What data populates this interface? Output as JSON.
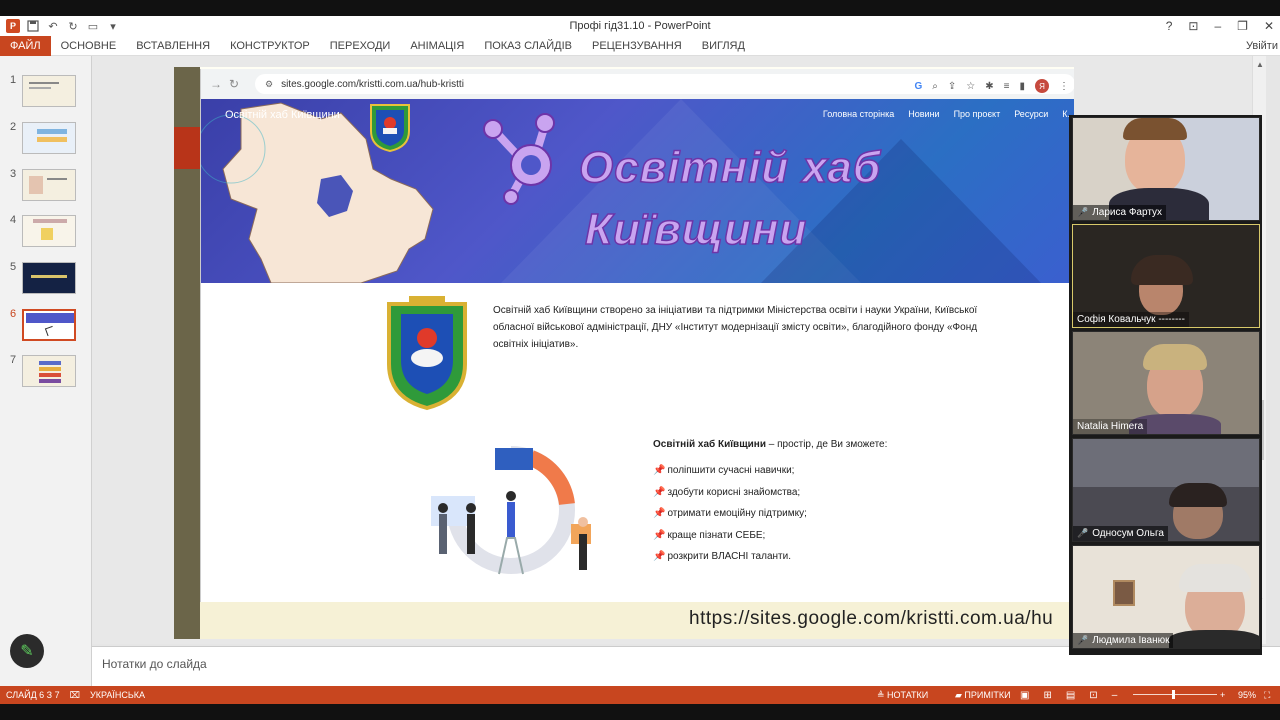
{
  "app": {
    "window_title": "Профі гід31.10 - PowerPoint",
    "user": "Увійти",
    "quick_access": [
      "save-icon",
      "undo-icon",
      "redo-icon",
      "present-icon",
      "customize-icon"
    ]
  },
  "ribbon": {
    "tabs": [
      "ФАЙЛ",
      "ОСНОВНЕ",
      "ВСТАВЛЕННЯ",
      "КОНСТРУКТОР",
      "ПЕРЕХОДИ",
      "АНІМАЦІЯ",
      "ПОКАЗ СЛАЙДІВ",
      "РЕЦЕНЗУВАННЯ",
      "ВИГЛЯД"
    ]
  },
  "thumbnails": {
    "numbers": [
      "1",
      "2",
      "3",
      "4",
      "5",
      "6",
      "7"
    ],
    "active": "6"
  },
  "slide": {
    "url_caption": "https://sites.google.com/kristti.com.ua/hu",
    "browser": {
      "address": "sites.google.com/kristti.com.ua/hub-kristti",
      "site_title": "Освітній хаб Київщини",
      "nav": [
        "Головна сторінка",
        "Новини",
        "Про проєкт",
        "Ресурси",
        "К..."
      ],
      "hero_line1": "Освітній хаб",
      "hero_line2": "Київщини",
      "intro_text": "Освітній хаб Київщини створено за ініціативи та підтримки Міністерства освіти і науки України, Київської обласної військової адміністрації, ДНУ «Інститут модернізації змісту освіти», благодійного фонду «Фонд освітніх ініціатив».",
      "feature_title_bold": "Освітній хаб Київщини",
      "feature_title_rest": " – простір, де Ви зможете:",
      "features": [
        "поліпшити сучасні навички;",
        "здобути корисні знайомства;",
        "отримати емоційну підтримку;",
        "краще пізнати СЕБЕ;",
        "розкрити ВЛАСНІ таланти."
      ]
    }
  },
  "notes_placeholder": "Нотатки до слайда",
  "participants": [
    {
      "name": "Лариса Фартух",
      "muted": true
    },
    {
      "name": "Софія Ковальчук --------",
      "muted": false
    },
    {
      "name": "Natalia Himera",
      "muted": false
    },
    {
      "name": "Односум Ольга",
      "muted": true
    },
    {
      "name": "Людмила Іванюк",
      "muted": true
    }
  ],
  "status": {
    "slide_counter": "СЛАЙД 6 З 7",
    "language": "УКРАЇНСЬКА",
    "notes": "НОТАТКИ",
    "comments": "ПРИМІТКИ",
    "zoom": "95%",
    "zoom_level_percent": 95
  },
  "colors": {
    "accent": "#c8461f",
    "hero_title": "#c9a4f0",
    "hero_bg": "#4f57c9"
  }
}
